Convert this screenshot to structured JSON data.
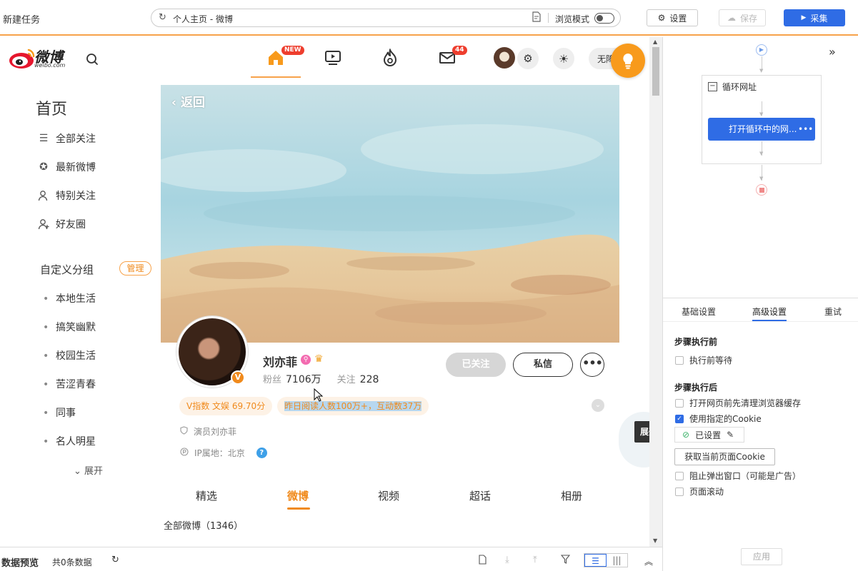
{
  "app": {
    "task_title": "新建任务",
    "url": "个人主页 - 微博",
    "browse_mode_label": "浏览模式",
    "settings_label": "设置",
    "save_label": "保存",
    "collect_label": "采集"
  },
  "weibo": {
    "logo_text": "微博",
    "logo_sub": "weibo.com",
    "nav": {
      "home_badge": "NEW",
      "mail_badge": "44",
      "pill_text": "无障"
    },
    "sidebar": {
      "home": "首页",
      "items": [
        "全部关注",
        "最新微博",
        "特别关注",
        "好友圈"
      ],
      "custom_title": "自定义分组",
      "manage_label": "管理",
      "groups": [
        "本地生活",
        "搞笑幽默",
        "校园生活",
        "苦涩青春",
        "同事",
        "名人明星"
      ],
      "expand_label": "展开"
    },
    "profile": {
      "back_label": "返回",
      "name": "刘亦菲",
      "fans_label": "粉丝",
      "fans_value": "7106万",
      "following_label": "关注",
      "following_value": "228",
      "followed_label": "已关注",
      "message_label": "私信",
      "more_label": "•••",
      "v_index": "V指数 文娱 69.70分",
      "reads": "昨日阅读人数100万+，互动数37万",
      "verified_info": "演员刘亦菲",
      "ip_location": "IP属地：北京",
      "tooltip": "展开"
    },
    "tabs": [
      "精选",
      "微博",
      "视频",
      "超话",
      "相册"
    ],
    "active_tab": "微博",
    "all_weibo": "全部微博（1346）"
  },
  "data_bar": {
    "title": "数据预览",
    "count": "共0条数据"
  },
  "flow": {
    "loop_label": "循环网址",
    "node_label": "打开循环中的网...",
    "node_more": "•••"
  },
  "settings_panel": {
    "tabs": [
      "基础设置",
      "高级设置",
      "重试"
    ],
    "active_tab": "高级设置",
    "before_title": "步骤执行前",
    "before_options": [
      {
        "label": "执行前等待",
        "checked": false
      }
    ],
    "after_title": "步骤执行后",
    "after_options": [
      {
        "label": "打开网页前先清理浏览器缓存",
        "checked": false
      },
      {
        "label": "使用指定的Cookie",
        "checked": true
      }
    ],
    "cookie_set_label": "已设置",
    "get_cookie_label": "获取当前页面Cookie",
    "extra_options": [
      {
        "label": "阻止弹出窗口（可能是广告）",
        "checked": false
      },
      {
        "label": "页面滚动",
        "checked": false
      }
    ],
    "apply_label": "应用"
  },
  "colors": {
    "accent_orange": "#f08a1c",
    "accent_blue": "#2f6ce5",
    "badge_red": "#ee3e2e"
  }
}
